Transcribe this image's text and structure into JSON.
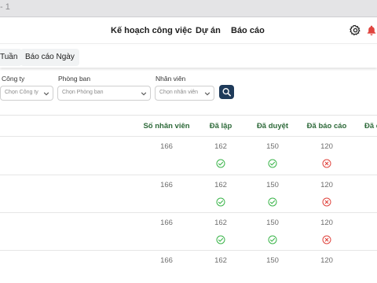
{
  "window": {
    "title_fragment": "- 1"
  },
  "nav": {
    "items": [
      {
        "label": "Kế hoạch công việc"
      },
      {
        "label": "Dự án"
      },
      {
        "label": "Báo cáo"
      }
    ]
  },
  "subtabs": [
    {
      "label": "Tuần"
    },
    {
      "label": "Báo cáo Ngày"
    }
  ],
  "filters": {
    "company": {
      "label": "Công ty",
      "placeholder": "Chọn Công ty"
    },
    "department": {
      "label": "Phòng ban",
      "placeholder": "Chọn Phòng ban"
    },
    "employee": {
      "label": "Nhân viên",
      "placeholder": "Chọn nhân viên"
    }
  },
  "table": {
    "headers": {
      "employees": "Số nhân viên",
      "created": "Đã lập",
      "approved": "Đã duyệt",
      "reported": "Đã báo cáo",
      "extra": "Đã c"
    },
    "rows": [
      {
        "employees": "166",
        "created": "162",
        "approved": "150",
        "reported": "120",
        "created_status": "check",
        "approved_status": "check",
        "reported_status": "cross"
      },
      {
        "employees": "166",
        "created": "162",
        "approved": "150",
        "reported": "120",
        "created_status": "check",
        "approved_status": "check",
        "reported_status": "cross"
      },
      {
        "employees": "166",
        "created": "162",
        "approved": "150",
        "reported": "120",
        "created_status": "check",
        "approved_status": "check",
        "reported_status": "cross"
      },
      {
        "employees": "166",
        "created": "162",
        "approved": "150",
        "reported": "120"
      }
    ]
  },
  "colors": {
    "header_text": "#2e6a3a",
    "check": "#3bb54a",
    "cross": "#e0443e",
    "search_button": "#1f3b5a",
    "bell": "#e0443e"
  },
  "icons": {
    "settings": "gear-icon",
    "notifications": "bell-icon",
    "search": "search-icon",
    "dropdown": "chevron-down-icon",
    "ok": "check-circle-icon",
    "fail": "x-circle-icon"
  }
}
